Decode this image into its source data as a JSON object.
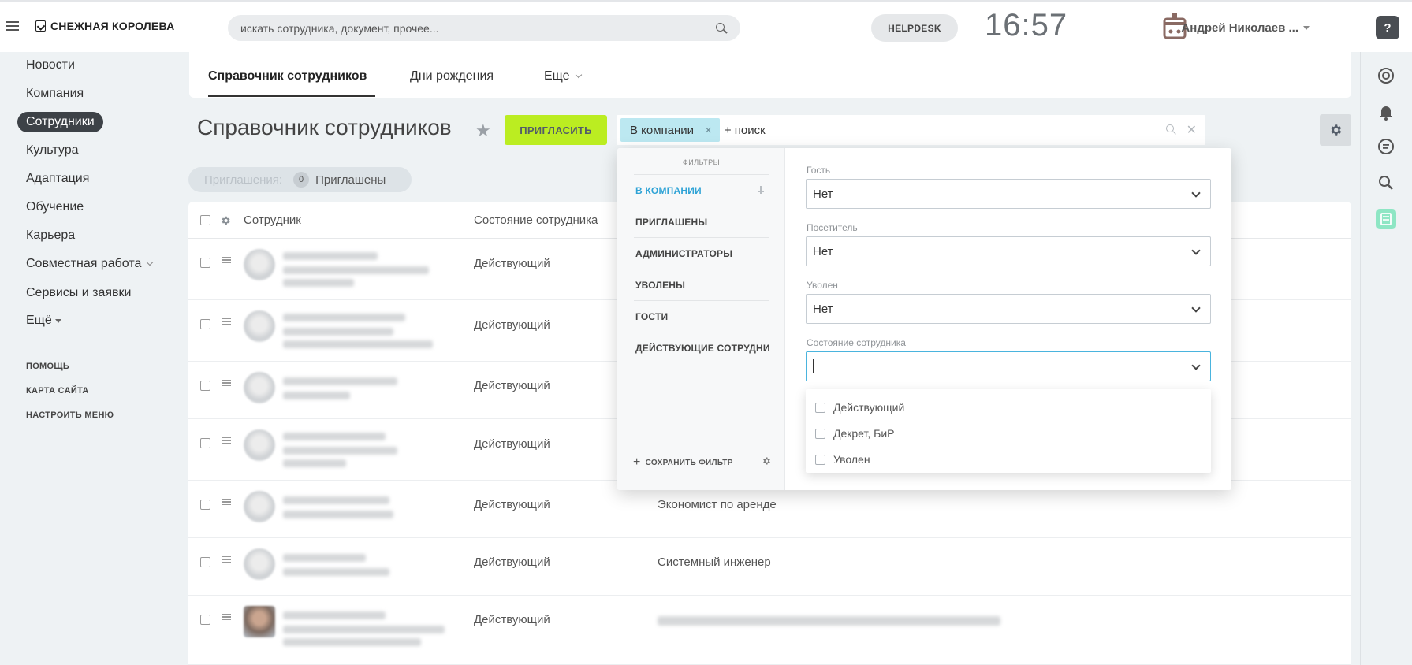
{
  "header": {
    "logo_text": "СНЕЖНАЯ КОРОЛЕВА",
    "search_placeholder": "искать сотрудника, документ, прочее...",
    "helpdesk_label": "HELPDESK",
    "clock": "16:57",
    "user_name": "Андрей Николаев ...",
    "help_label": "?"
  },
  "sidebar": {
    "items": [
      {
        "label": "Новости"
      },
      {
        "label": "Компания"
      },
      {
        "label": "Сотрудники"
      },
      {
        "label": "Культура"
      },
      {
        "label": "Адаптация"
      },
      {
        "label": "Обучение"
      },
      {
        "label": "Карьера"
      },
      {
        "label": "Совместная работа"
      },
      {
        "label": "Сервисы и заявки"
      },
      {
        "label": "Ещё"
      }
    ],
    "footer": [
      "ПОМОЩЬ",
      "КАРТА САЙТА",
      "НАСТРОИТЬ МЕНЮ"
    ]
  },
  "tabs": [
    {
      "label": "Справочник сотрудников"
    },
    {
      "label": "Дни рождения"
    },
    {
      "label": "Еще"
    }
  ],
  "toolbar": {
    "title": "Справочник сотрудников",
    "invite_label": "ПРИГЛАСИТЬ",
    "filter_chip": "В компании",
    "filter_placeholder": "+ поиск"
  },
  "invitations": {
    "label": "Приглашения:",
    "count": "0",
    "value": "Приглашены"
  },
  "grid": {
    "columns": [
      "Сотрудник",
      "Состояние сотрудника"
    ],
    "rows": [
      {
        "state": "Действующий",
        "post": ""
      },
      {
        "state": "Действующий",
        "post": ""
      },
      {
        "state": "Действующий",
        "post": ""
      },
      {
        "state": "Действующий",
        "post": ""
      },
      {
        "state": "Действующий",
        "post": "Экономист по аренде"
      },
      {
        "state": "Действующий",
        "post": "Системный инженер"
      },
      {
        "state": "Действующий",
        "post": ""
      }
    ]
  },
  "filter_popup": {
    "heading": "ФИЛЬТРЫ",
    "presets": [
      {
        "label": "В КОМПАНИИ"
      },
      {
        "label": "ПРИГЛАШЕНЫ"
      },
      {
        "label": "АДМИНИСТРАТОРЫ"
      },
      {
        "label": "УВОЛЕНЫ"
      },
      {
        "label": "ГОСТИ"
      },
      {
        "label": "ДЕЙСТВУЮЩИЕ СОТРУДНИ..."
      }
    ],
    "save_label": "СОХРАНИТЬ ФИЛЬТР",
    "fields": [
      {
        "label": "Гость",
        "value": "Нет"
      },
      {
        "label": "Посетитель",
        "value": "Нет"
      },
      {
        "label": "Уволен",
        "value": "Нет"
      },
      {
        "label": "Состояние сотрудника",
        "value": ""
      }
    ],
    "options": [
      {
        "label": "Действующий"
      },
      {
        "label": "Декрет, БиР"
      },
      {
        "label": "Уволен"
      }
    ]
  },
  "colors": {
    "accent_green": "#bbed21",
    "active_blue": "#2fa3d6",
    "chip_blue": "#bce8f1",
    "nav_active": "#3d4247"
  }
}
